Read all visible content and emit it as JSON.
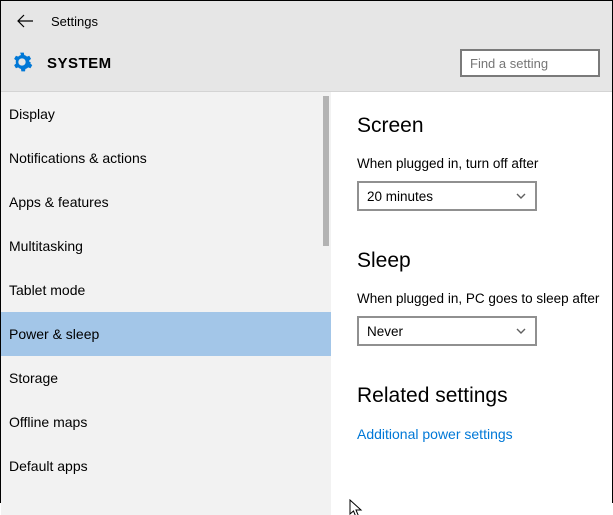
{
  "header": {
    "app_title": "Settings",
    "page_title": "SYSTEM",
    "search_placeholder": "Find a setting"
  },
  "sidebar": {
    "items": [
      {
        "label": "Display",
        "id": "display"
      },
      {
        "label": "Notifications & actions",
        "id": "notifications"
      },
      {
        "label": "Apps & features",
        "id": "apps-features"
      },
      {
        "label": "Multitasking",
        "id": "multitasking"
      },
      {
        "label": "Tablet mode",
        "id": "tablet-mode"
      },
      {
        "label": "Power & sleep",
        "id": "power-sleep",
        "selected": true
      },
      {
        "label": "Storage",
        "id": "storage"
      },
      {
        "label": "Offline maps",
        "id": "offline-maps"
      },
      {
        "label": "Default apps",
        "id": "default-apps"
      }
    ]
  },
  "main": {
    "screen": {
      "title": "Screen",
      "label": "When plugged in, turn off after",
      "value": "20 minutes"
    },
    "sleep": {
      "title": "Sleep",
      "label": "When plugged in, PC goes to sleep after",
      "value": "Never"
    },
    "related": {
      "title": "Related settings",
      "link": "Additional power settings"
    }
  }
}
